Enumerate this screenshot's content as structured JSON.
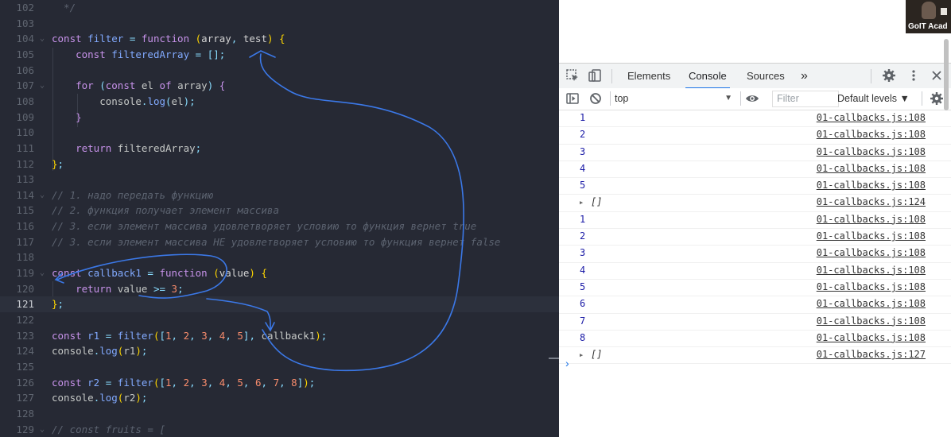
{
  "editor": {
    "lines": [
      {
        "n": "102",
        "tokens": [
          [
            "cm",
            "  */"
          ]
        ]
      },
      {
        "n": "103",
        "tokens": []
      },
      {
        "n": "104",
        "fold": "⌄",
        "tokens": [
          [
            "kw",
            "const "
          ],
          [
            "var",
            "filter "
          ],
          [
            "op",
            "= "
          ],
          [
            "kw",
            "function "
          ],
          [
            "br",
            "("
          ],
          [
            "param",
            "array"
          ],
          [
            "pun",
            ", "
          ],
          [
            "param",
            "test"
          ],
          [
            "br",
            ") "
          ],
          [
            "br",
            "{"
          ]
        ]
      },
      {
        "n": "105",
        "tokens": [
          [
            "plain",
            "    "
          ],
          [
            "kw",
            "const "
          ],
          [
            "var",
            "filteredArray "
          ],
          [
            "op",
            "= "
          ],
          [
            "pun",
            "[];"
          ]
        ]
      },
      {
        "n": "106",
        "tokens": []
      },
      {
        "n": "107",
        "fold": "⌄",
        "tokens": [
          [
            "plain",
            "    "
          ],
          [
            "kw",
            "for "
          ],
          [
            "pun",
            "("
          ],
          [
            "kw",
            "const "
          ],
          [
            "plain",
            "el "
          ],
          [
            "kw",
            "of "
          ],
          [
            "plain",
            "array"
          ],
          [
            "pun",
            ") "
          ],
          [
            "kw",
            "{"
          ]
        ]
      },
      {
        "n": "108",
        "tokens": [
          [
            "plain",
            "        "
          ],
          [
            "plain",
            "console"
          ],
          [
            "pun",
            "."
          ],
          [
            "fn",
            "log"
          ],
          [
            "pun",
            "("
          ],
          [
            "plain",
            "el"
          ],
          [
            "pun",
            ");"
          ]
        ]
      },
      {
        "n": "109",
        "tokens": [
          [
            "plain",
            "    "
          ],
          [
            "kw",
            "}"
          ]
        ]
      },
      {
        "n": "110",
        "tokens": []
      },
      {
        "n": "111",
        "tokens": [
          [
            "plain",
            "    "
          ],
          [
            "kw",
            "return "
          ],
          [
            "plain",
            "filteredArray"
          ],
          [
            "pun",
            ";"
          ]
        ]
      },
      {
        "n": "112",
        "tokens": [
          [
            "br",
            "}"
          ],
          [
            "pun",
            ";"
          ]
        ]
      },
      {
        "n": "113",
        "tokens": []
      },
      {
        "n": "114",
        "fold": "⌄",
        "tokens": [
          [
            "cm",
            "// 1. надо передать функцию"
          ]
        ]
      },
      {
        "n": "115",
        "tokens": [
          [
            "cm",
            "// 2. функция получает элемент массива"
          ]
        ]
      },
      {
        "n": "116",
        "tokens": [
          [
            "cm",
            "// 3. если элемент массива удовлетворяет условию то функция вернет true"
          ]
        ]
      },
      {
        "n": "117",
        "tokens": [
          [
            "cm",
            "// 3. если элемент массива НЕ удовлетворяет условию то функция вернет false"
          ]
        ]
      },
      {
        "n": "118",
        "tokens": []
      },
      {
        "n": "119",
        "fold": "⌄",
        "tokens": [
          [
            "kw",
            "const "
          ],
          [
            "var",
            "callback1 "
          ],
          [
            "op",
            "= "
          ],
          [
            "kw",
            "function "
          ],
          [
            "br",
            "("
          ],
          [
            "param",
            "value"
          ],
          [
            "br",
            ") "
          ],
          [
            "br",
            "{"
          ]
        ]
      },
      {
        "n": "120",
        "tokens": [
          [
            "plain",
            "    "
          ],
          [
            "kw",
            "return "
          ],
          [
            "plain",
            "value "
          ],
          [
            "op",
            ">= "
          ],
          [
            "num",
            "3"
          ],
          [
            "pun",
            ";"
          ]
        ]
      },
      {
        "n": "121",
        "active": true,
        "tokens": [
          [
            "br",
            "}"
          ],
          [
            "pun",
            ";"
          ]
        ]
      },
      {
        "n": "122",
        "tokens": []
      },
      {
        "n": "123",
        "tokens": [
          [
            "kw",
            "const "
          ],
          [
            "var",
            "r1 "
          ],
          [
            "op",
            "= "
          ],
          [
            "fn",
            "filter"
          ],
          [
            "br",
            "("
          ],
          [
            "pun",
            "["
          ],
          [
            "num",
            "1"
          ],
          [
            "pun",
            ", "
          ],
          [
            "num",
            "2"
          ],
          [
            "pun",
            ", "
          ],
          [
            "num",
            "3"
          ],
          [
            "pun",
            ", "
          ],
          [
            "num",
            "4"
          ],
          [
            "pun",
            ", "
          ],
          [
            "num",
            "5"
          ],
          [
            "pun",
            "]"
          ],
          [
            "pun",
            ", "
          ],
          [
            "plain",
            "callback1"
          ],
          [
            "br",
            ")"
          ],
          [
            "pun",
            ";"
          ]
        ]
      },
      {
        "n": "124",
        "tokens": [
          [
            "plain",
            "console"
          ],
          [
            "pun",
            "."
          ],
          [
            "fn",
            "log"
          ],
          [
            "br",
            "("
          ],
          [
            "plain",
            "r1"
          ],
          [
            "br",
            ")"
          ],
          [
            "pun",
            ";"
          ]
        ]
      },
      {
        "n": "125",
        "tokens": []
      },
      {
        "n": "126",
        "tokens": [
          [
            "kw",
            "const "
          ],
          [
            "var",
            "r2 "
          ],
          [
            "op",
            "= "
          ],
          [
            "fn",
            "filter"
          ],
          [
            "br",
            "("
          ],
          [
            "pun",
            "["
          ],
          [
            "num",
            "1"
          ],
          [
            "pun",
            ", "
          ],
          [
            "num",
            "2"
          ],
          [
            "pun",
            ", "
          ],
          [
            "num",
            "3"
          ],
          [
            "pun",
            ", "
          ],
          [
            "num",
            "4"
          ],
          [
            "pun",
            ", "
          ],
          [
            "num",
            "5"
          ],
          [
            "pun",
            ", "
          ],
          [
            "num",
            "6"
          ],
          [
            "pun",
            ", "
          ],
          [
            "num",
            "7"
          ],
          [
            "pun",
            ", "
          ],
          [
            "num",
            "8"
          ],
          [
            "pun",
            "]"
          ],
          [
            "br",
            ")"
          ],
          [
            "pun",
            ";"
          ]
        ]
      },
      {
        "n": "127",
        "tokens": [
          [
            "plain",
            "console"
          ],
          [
            "pun",
            "."
          ],
          [
            "fn",
            "log"
          ],
          [
            "br",
            "("
          ],
          [
            "plain",
            "r2"
          ],
          [
            "br",
            ")"
          ],
          [
            "pun",
            ";"
          ]
        ]
      },
      {
        "n": "128",
        "tokens": []
      },
      {
        "n": "129",
        "fold": "⌄",
        "tokens": [
          [
            "cm",
            "// const fruits = ["
          ]
        ]
      }
    ]
  },
  "devtools": {
    "video_label": "GoIT Acad",
    "tabs": [
      {
        "label": "Elements",
        "active": false
      },
      {
        "label": "Console",
        "active": true
      },
      {
        "label": "Sources",
        "active": false
      }
    ],
    "more_tabs": "»",
    "context": "top",
    "filter_placeholder": "Filter",
    "levels": "Default levels ▼",
    "log": [
      {
        "value": "1",
        "source": "01-callbacks.js:108"
      },
      {
        "value": "2",
        "source": "01-callbacks.js:108"
      },
      {
        "value": "3",
        "source": "01-callbacks.js:108"
      },
      {
        "value": "4",
        "source": "01-callbacks.js:108"
      },
      {
        "value": "5",
        "source": "01-callbacks.js:108"
      },
      {
        "value": "[]",
        "source": "01-callbacks.js:124",
        "array": true
      },
      {
        "value": "1",
        "source": "01-callbacks.js:108"
      },
      {
        "value": "2",
        "source": "01-callbacks.js:108"
      },
      {
        "value": "3",
        "source": "01-callbacks.js:108"
      },
      {
        "value": "4",
        "source": "01-callbacks.js:108"
      },
      {
        "value": "5",
        "source": "01-callbacks.js:108"
      },
      {
        "value": "6",
        "source": "01-callbacks.js:108"
      },
      {
        "value": "7",
        "source": "01-callbacks.js:108"
      },
      {
        "value": "8",
        "source": "01-callbacks.js:108"
      },
      {
        "value": "[]",
        "source": "01-callbacks.js:127",
        "array": true
      }
    ],
    "prompt": "›"
  },
  "colors": {
    "editor_bg": "#262934",
    "accent": "#1a73e8",
    "annotation": "#3b78e7"
  }
}
